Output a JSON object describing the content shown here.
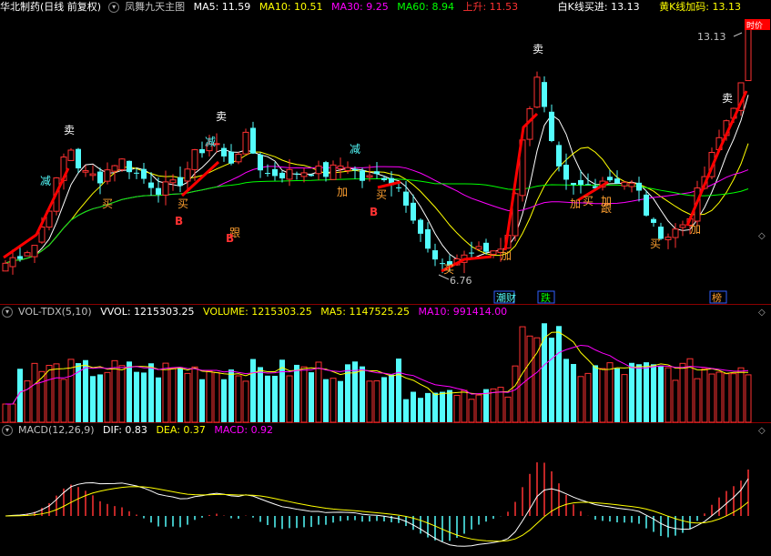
{
  "main": {
    "title": "华北制药(日线 前复权)",
    "indicator": "凤舞九天主图",
    "ma5": "MA5: 11.59",
    "ma10": "MA10: 10.51",
    "ma30": "MA30: 9.25",
    "ma60": "MA60: 8.94",
    "rise": "上升: 11.53",
    "white_k": "白K线买进: 13.13",
    "yellow_k": "黄K线加码: 13.13",
    "high_label": "13.13",
    "low_label": "6.76",
    "badge": "时价"
  },
  "events": [
    "潮财",
    "跌",
    "榜"
  ],
  "vol": {
    "name": "VOL-TDX(5,10)",
    "vvol": "VVOL: 1215303.25",
    "volume": "VOLUME: 1215303.25",
    "ma5": "MA5: 1147525.25",
    "ma10": "MA10: 991414.00"
  },
  "macd": {
    "name": "MACD(12,26,9)",
    "dif": "DIF: 0.83",
    "dea": "DEA: 0.37",
    "macd": "MACD: 0.92"
  },
  "signals": {
    "sell": "卖",
    "reduce": "减",
    "buy": "买",
    "add": "加",
    "follow": "跟",
    "b": "B"
  },
  "colors": {
    "up": "#ff3232",
    "down": "#54fcfc",
    "ma5": "#ffffff",
    "ma10": "#ffff00",
    "ma30": "#ff00ff",
    "ma60": "#00ff00",
    "trend": "#ff0000",
    "separator": "#8b0000"
  }
}
